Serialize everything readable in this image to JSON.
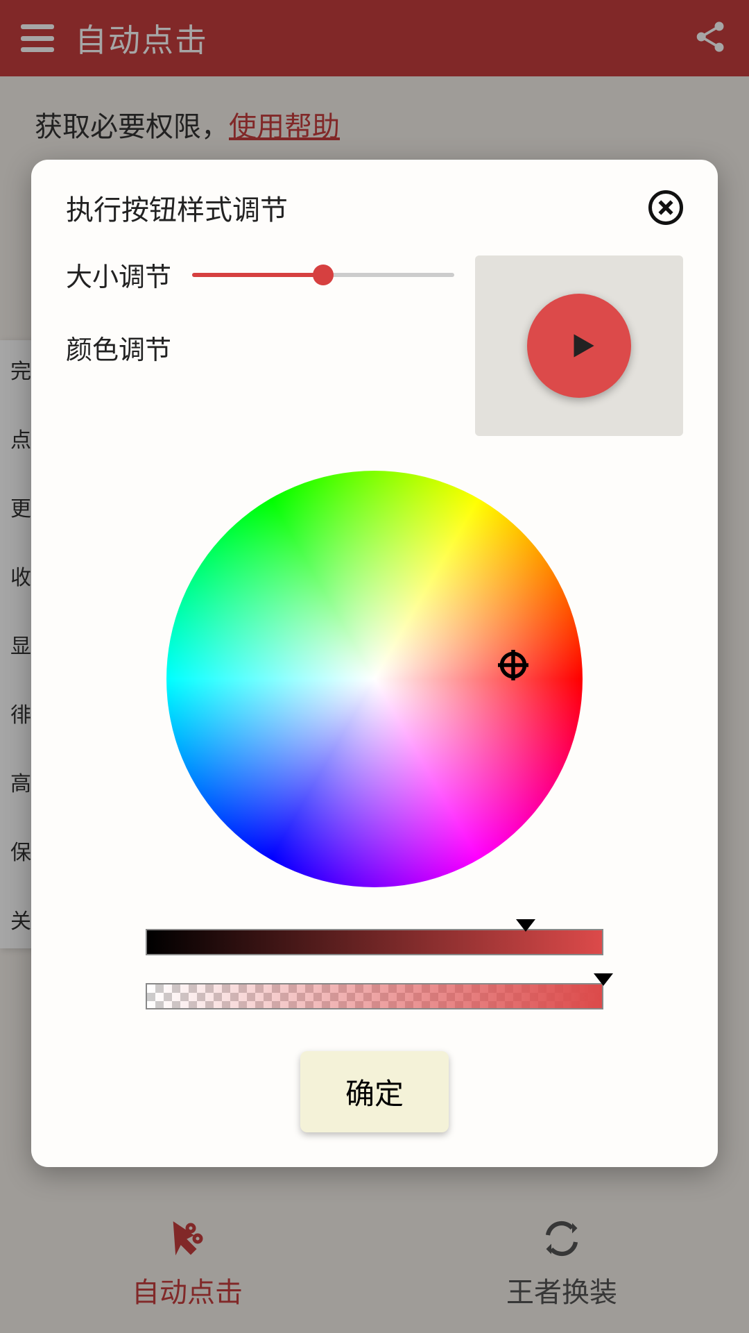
{
  "header": {
    "title": "自动点击"
  },
  "permission": {
    "text": "获取必要权限，",
    "link": "使用帮助"
  },
  "sidePanel": {
    "items": [
      "完",
      "点",
      "更",
      "收",
      "显",
      "徘",
      "高",
      "保",
      "关"
    ]
  },
  "bottomNav": {
    "tabs": [
      {
        "label": "自动点击",
        "active": true
      },
      {
        "label": "王者换装",
        "active": false
      }
    ]
  },
  "dialog": {
    "title": "执行按钮样式调节",
    "sizeLabel": "大小调节",
    "colorLabel": "颜色调节",
    "sizeValuePercent": 50,
    "brightnessPercent": 83,
    "opacityPercent": 100,
    "selectedColor": "#dc4a4a",
    "confirmLabel": "确定"
  }
}
